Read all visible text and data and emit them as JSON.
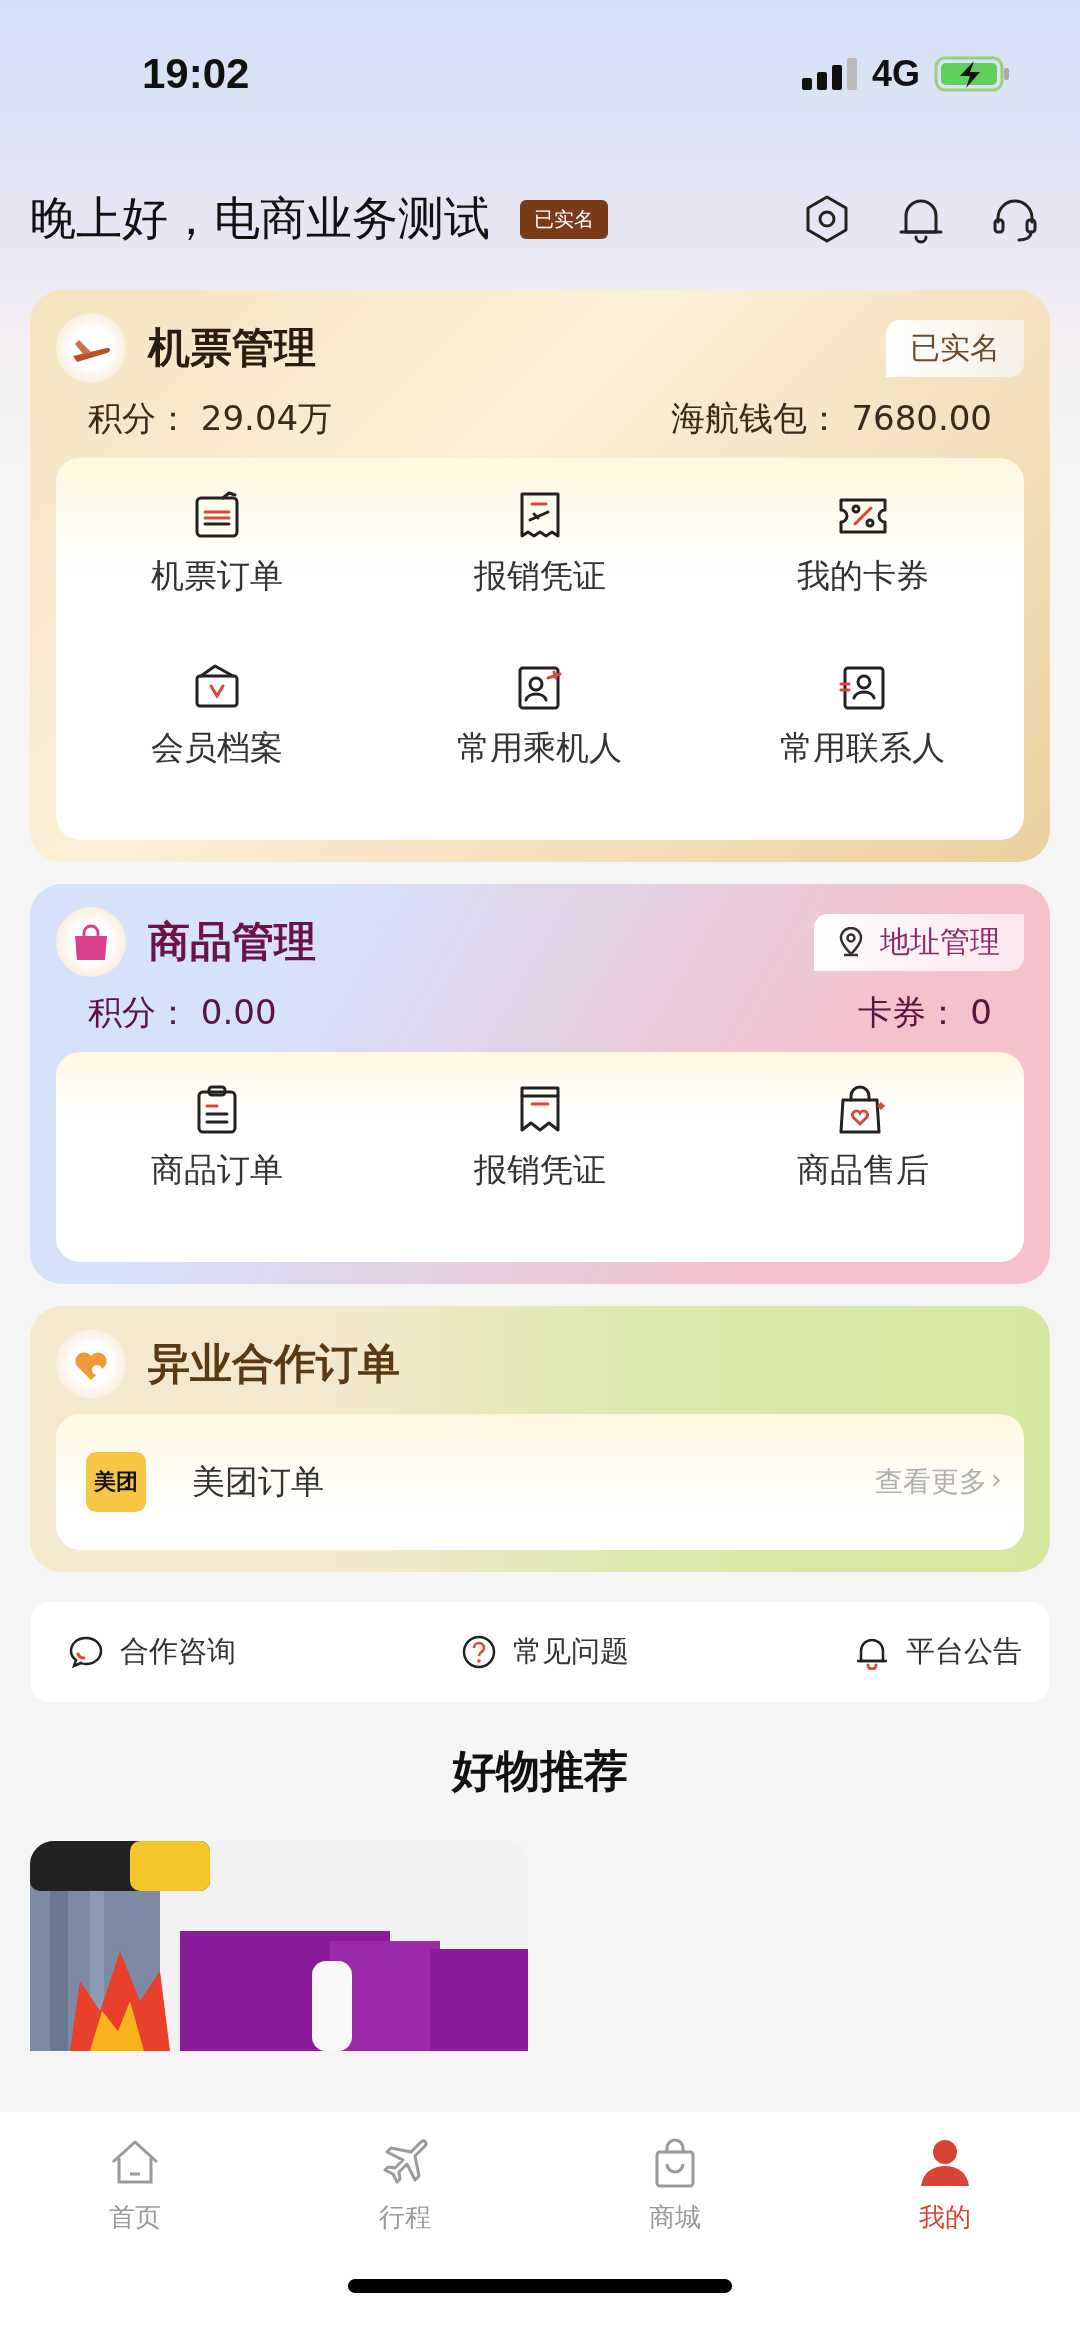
{
  "status_bar": {
    "time": "19:02",
    "network": "4G"
  },
  "header": {
    "greeting": "晚上好，电商业务测试",
    "badge": "已实名"
  },
  "flight_card": {
    "title": "机票管理",
    "badge": "已实名",
    "points_label": "积分：",
    "points": "29.04万",
    "wallet_label": "海航钱包：",
    "wallet": "7680.00",
    "items": [
      {
        "label": "机票订单"
      },
      {
        "label": "报销凭证"
      },
      {
        "label": "我的卡券"
      },
      {
        "label": "会员档案"
      },
      {
        "label": "常用乘机人"
      },
      {
        "label": "常用联系人"
      }
    ]
  },
  "goods_card": {
    "title": "商品管理",
    "address_button": "地址管理",
    "points_label": "积分：",
    "points": "0.00",
    "coupons_label": "卡券：",
    "coupons": "0",
    "items": [
      {
        "label": "商品订单"
      },
      {
        "label": "报销凭证"
      },
      {
        "label": "商品售后"
      }
    ]
  },
  "partner_card": {
    "title": "异业合作订单",
    "row": {
      "logo": "美团",
      "label": "美团订单",
      "more": "查看更多",
      "chevron": "›"
    }
  },
  "links": [
    {
      "label": "合作咨询"
    },
    {
      "label": "常见问题"
    },
    {
      "label": "平台公告"
    }
  ],
  "recommend": {
    "title": "好物推荐"
  },
  "tab_bar": [
    {
      "label": "首页",
      "selected": false
    },
    {
      "label": "行程",
      "selected": false
    },
    {
      "label": "商城",
      "selected": false
    },
    {
      "label": "我的",
      "selected": true
    }
  ]
}
